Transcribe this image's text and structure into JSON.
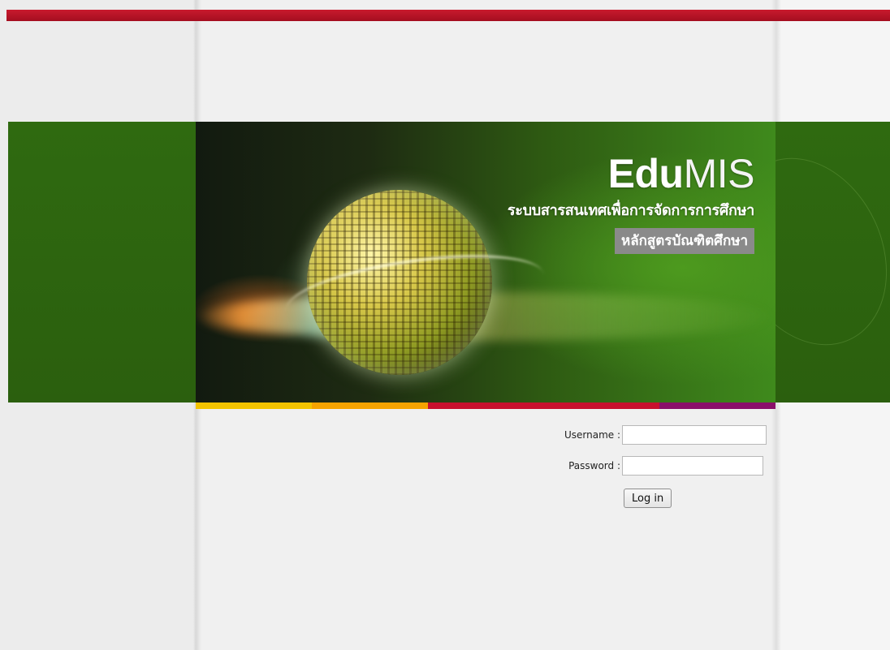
{
  "banner": {
    "logo_bold": "Edu",
    "logo_light": "MIS",
    "subtitle": "ระบบสารสนเทศเพื่อการจัดการการศึกษา",
    "program": "หลักสูตรบัณฑิตศึกษา"
  },
  "colors": {
    "top_bar": "#b31225",
    "band_green": "#2d650f",
    "strip": [
      "#f2c300",
      "#f5a300",
      "#c8102e",
      "#c8102e",
      "#8a0f6a"
    ]
  },
  "login": {
    "username_label": "Username :",
    "username_value": "",
    "password_label": "Password :",
    "password_value": "",
    "button_label": "Log in"
  }
}
